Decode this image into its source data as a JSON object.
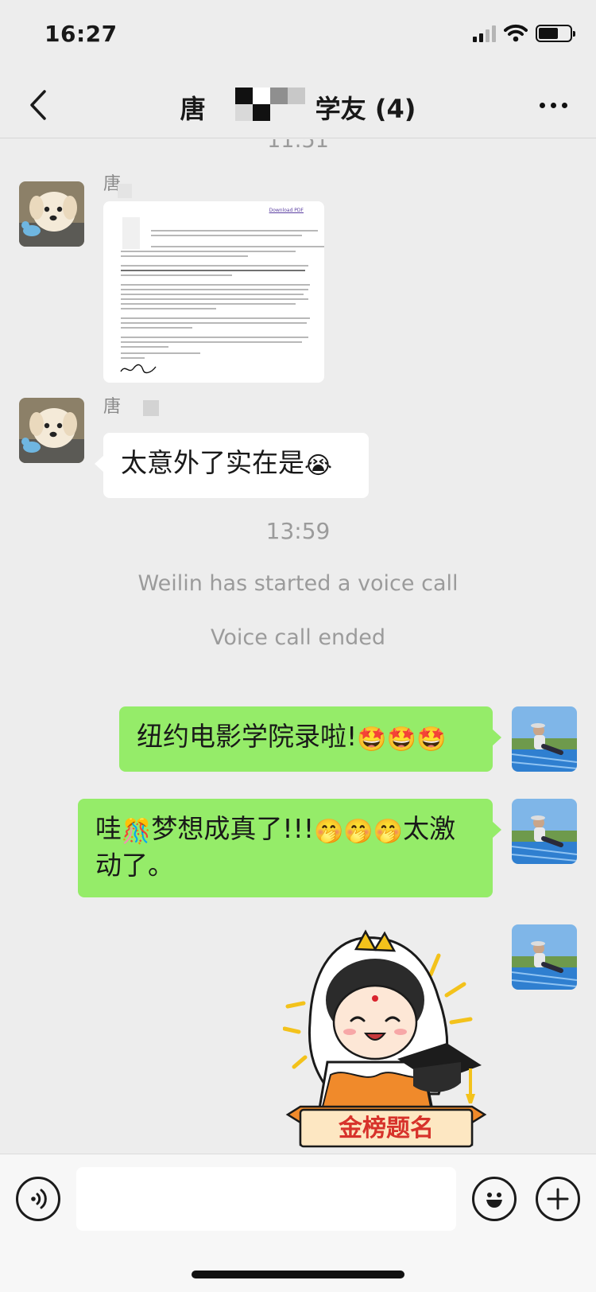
{
  "status_bar": {
    "time": "16:27",
    "wifi_icon": "wifi-icon",
    "signal_icon": "cellular-signal-icon",
    "battery_icon": "battery-icon"
  },
  "nav": {
    "back_icon": "chevron-left-icon",
    "title_prefix": "唐",
    "title_suffix": "学友 (4)",
    "more_icon": "more-dots-icon"
  },
  "chat": {
    "top_time_partial": "11:51",
    "messages": [
      {
        "side": "left",
        "sender": "唐",
        "type": "document-image",
        "doc": {
          "link": "Download PDF"
        }
      },
      {
        "side": "left",
        "sender": "唐",
        "type": "text",
        "text": "太意外了实在是",
        "emoji": "😭"
      },
      {
        "side": "right",
        "type": "text",
        "text": "纽约电影学院录啦!",
        "emoji": "🤩🤩🤩"
      },
      {
        "side": "right",
        "type": "text",
        "text_a": "哇",
        "emoji_a": "🎊",
        "text_b": "梦想成真了!!!",
        "emoji_b": "🤭🤭🤭",
        "text_c": "太激动了。"
      },
      {
        "side": "right",
        "type": "sticker",
        "sticker_text": "金榜题名"
      }
    ],
    "system": {
      "time": "13:59",
      "voice_call_started": "Weilin has started a voice call",
      "voice_call_ended": "Voice call ended"
    }
  },
  "input_bar": {
    "voice_icon": "voice-input-icon",
    "emoji_icon": "emoji-icon",
    "plus_icon": "plus-icon",
    "placeholder": ""
  },
  "colors": {
    "background": "#ededed",
    "bubble_out": "#95ec69",
    "bubble_in": "#ffffff"
  }
}
